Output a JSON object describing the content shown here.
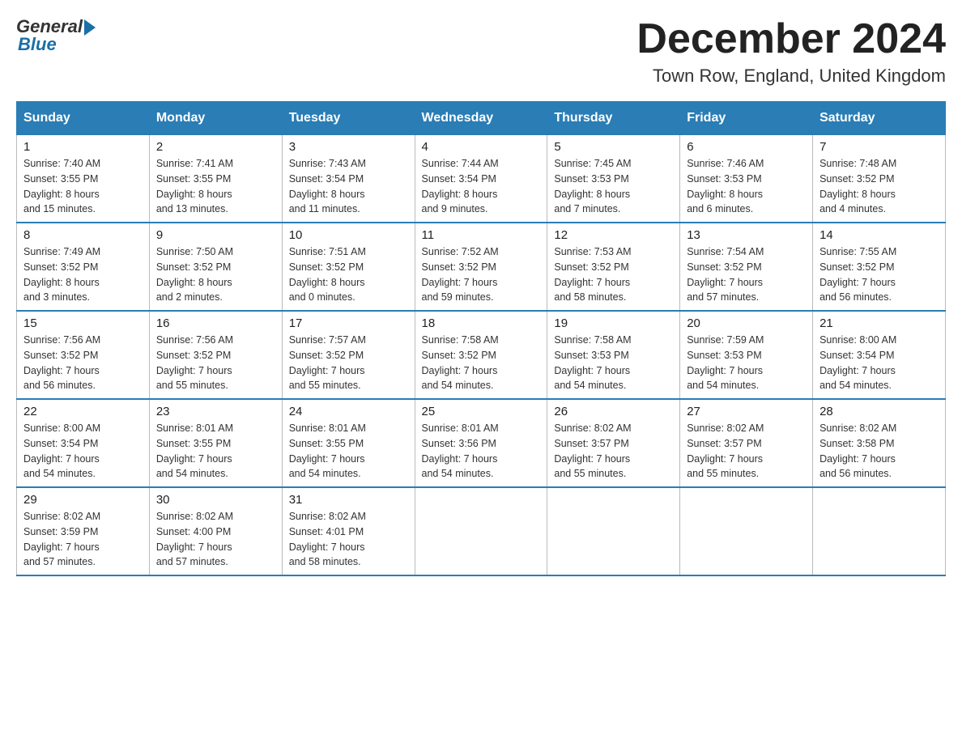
{
  "logo": {
    "general": "General",
    "blue": "Blue"
  },
  "title": "December 2024",
  "location": "Town Row, England, United Kingdom",
  "days_of_week": [
    "Sunday",
    "Monday",
    "Tuesday",
    "Wednesday",
    "Thursday",
    "Friday",
    "Saturday"
  ],
  "weeks": [
    [
      {
        "day": "1",
        "info": "Sunrise: 7:40 AM\nSunset: 3:55 PM\nDaylight: 8 hours\nand 15 minutes."
      },
      {
        "day": "2",
        "info": "Sunrise: 7:41 AM\nSunset: 3:55 PM\nDaylight: 8 hours\nand 13 minutes."
      },
      {
        "day": "3",
        "info": "Sunrise: 7:43 AM\nSunset: 3:54 PM\nDaylight: 8 hours\nand 11 minutes."
      },
      {
        "day": "4",
        "info": "Sunrise: 7:44 AM\nSunset: 3:54 PM\nDaylight: 8 hours\nand 9 minutes."
      },
      {
        "day": "5",
        "info": "Sunrise: 7:45 AM\nSunset: 3:53 PM\nDaylight: 8 hours\nand 7 minutes."
      },
      {
        "day": "6",
        "info": "Sunrise: 7:46 AM\nSunset: 3:53 PM\nDaylight: 8 hours\nand 6 minutes."
      },
      {
        "day": "7",
        "info": "Sunrise: 7:48 AM\nSunset: 3:52 PM\nDaylight: 8 hours\nand 4 minutes."
      }
    ],
    [
      {
        "day": "8",
        "info": "Sunrise: 7:49 AM\nSunset: 3:52 PM\nDaylight: 8 hours\nand 3 minutes."
      },
      {
        "day": "9",
        "info": "Sunrise: 7:50 AM\nSunset: 3:52 PM\nDaylight: 8 hours\nand 2 minutes."
      },
      {
        "day": "10",
        "info": "Sunrise: 7:51 AM\nSunset: 3:52 PM\nDaylight: 8 hours\nand 0 minutes."
      },
      {
        "day": "11",
        "info": "Sunrise: 7:52 AM\nSunset: 3:52 PM\nDaylight: 7 hours\nand 59 minutes."
      },
      {
        "day": "12",
        "info": "Sunrise: 7:53 AM\nSunset: 3:52 PM\nDaylight: 7 hours\nand 58 minutes."
      },
      {
        "day": "13",
        "info": "Sunrise: 7:54 AM\nSunset: 3:52 PM\nDaylight: 7 hours\nand 57 minutes."
      },
      {
        "day": "14",
        "info": "Sunrise: 7:55 AM\nSunset: 3:52 PM\nDaylight: 7 hours\nand 56 minutes."
      }
    ],
    [
      {
        "day": "15",
        "info": "Sunrise: 7:56 AM\nSunset: 3:52 PM\nDaylight: 7 hours\nand 56 minutes."
      },
      {
        "day": "16",
        "info": "Sunrise: 7:56 AM\nSunset: 3:52 PM\nDaylight: 7 hours\nand 55 minutes."
      },
      {
        "day": "17",
        "info": "Sunrise: 7:57 AM\nSunset: 3:52 PM\nDaylight: 7 hours\nand 55 minutes."
      },
      {
        "day": "18",
        "info": "Sunrise: 7:58 AM\nSunset: 3:52 PM\nDaylight: 7 hours\nand 54 minutes."
      },
      {
        "day": "19",
        "info": "Sunrise: 7:58 AM\nSunset: 3:53 PM\nDaylight: 7 hours\nand 54 minutes."
      },
      {
        "day": "20",
        "info": "Sunrise: 7:59 AM\nSunset: 3:53 PM\nDaylight: 7 hours\nand 54 minutes."
      },
      {
        "day": "21",
        "info": "Sunrise: 8:00 AM\nSunset: 3:54 PM\nDaylight: 7 hours\nand 54 minutes."
      }
    ],
    [
      {
        "day": "22",
        "info": "Sunrise: 8:00 AM\nSunset: 3:54 PM\nDaylight: 7 hours\nand 54 minutes."
      },
      {
        "day": "23",
        "info": "Sunrise: 8:01 AM\nSunset: 3:55 PM\nDaylight: 7 hours\nand 54 minutes."
      },
      {
        "day": "24",
        "info": "Sunrise: 8:01 AM\nSunset: 3:55 PM\nDaylight: 7 hours\nand 54 minutes."
      },
      {
        "day": "25",
        "info": "Sunrise: 8:01 AM\nSunset: 3:56 PM\nDaylight: 7 hours\nand 54 minutes."
      },
      {
        "day": "26",
        "info": "Sunrise: 8:02 AM\nSunset: 3:57 PM\nDaylight: 7 hours\nand 55 minutes."
      },
      {
        "day": "27",
        "info": "Sunrise: 8:02 AM\nSunset: 3:57 PM\nDaylight: 7 hours\nand 55 minutes."
      },
      {
        "day": "28",
        "info": "Sunrise: 8:02 AM\nSunset: 3:58 PM\nDaylight: 7 hours\nand 56 minutes."
      }
    ],
    [
      {
        "day": "29",
        "info": "Sunrise: 8:02 AM\nSunset: 3:59 PM\nDaylight: 7 hours\nand 57 minutes."
      },
      {
        "day": "30",
        "info": "Sunrise: 8:02 AM\nSunset: 4:00 PM\nDaylight: 7 hours\nand 57 minutes."
      },
      {
        "day": "31",
        "info": "Sunrise: 8:02 AM\nSunset: 4:01 PM\nDaylight: 7 hours\nand 58 minutes."
      },
      {
        "day": "",
        "info": ""
      },
      {
        "day": "",
        "info": ""
      },
      {
        "day": "",
        "info": ""
      },
      {
        "day": "",
        "info": ""
      }
    ]
  ]
}
